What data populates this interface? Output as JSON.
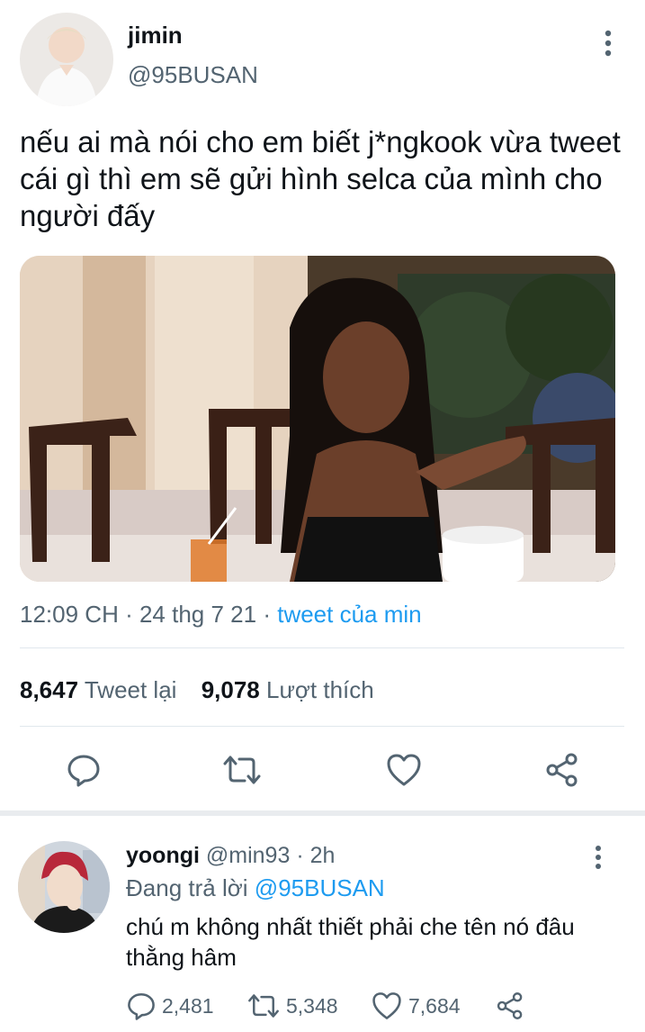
{
  "tweet": {
    "author_name": "jimin",
    "author_handle": "@95BUSAN",
    "text": "nếu ai mà nói cho em biết j*ngkook vừa tweet cái gì thì em sẽ gửi hình selca của mình cho người đấy",
    "time": "12:09 CH",
    "date": "24 thg 7 21",
    "source": "tweet của min",
    "retweets_count": "8,647",
    "retweets_label": "Tweet lại",
    "likes_count": "9,078",
    "likes_label": "Lượt thích"
  },
  "reply": {
    "author_name": "yoongi",
    "author_handle": "@min93",
    "age": "2h",
    "replying_to_prefix": "Đang trả lời",
    "replying_to_handle": "@95BUSAN",
    "text": "chú m không nhất thiết phải che tên nó đâu thằng hâm",
    "replies": "2,481",
    "retweets": "5,348",
    "likes": "7,684"
  },
  "icons": {
    "more": "more-vertical-icon",
    "reply": "comment-bubble-icon",
    "retweet": "retweet-icon",
    "like": "heart-icon",
    "share": "share-icon"
  },
  "colors": {
    "link": "#1d9bf0",
    "secondary_text": "#536471",
    "primary_text": "#0f1419"
  }
}
